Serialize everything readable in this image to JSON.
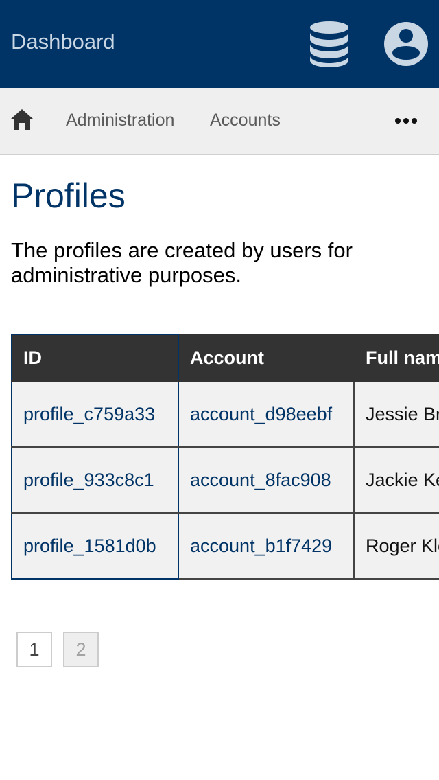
{
  "header": {
    "title": "Dashboard",
    "icons": [
      "database-icon",
      "user-account-icon"
    ]
  },
  "nav": {
    "home_icon": "home-icon",
    "items": [
      {
        "label": "Administration"
      },
      {
        "label": "Accounts"
      }
    ],
    "more_icon": "more-horizontal-icon"
  },
  "page": {
    "title": "Profiles",
    "description": "The profiles are created by users for administrative purposes."
  },
  "table": {
    "columns": [
      "ID",
      "Account",
      "Full name"
    ],
    "rows": [
      {
        "id": "profile_c759a33",
        "account": "account_d98eebf",
        "full_name": "Jessie Breitenberg"
      },
      {
        "id": "profile_933c8c1",
        "account": "account_8fac908",
        "full_name": "Jackie Keeling"
      },
      {
        "id": "profile_1581d0b",
        "account": "account_b1f7429",
        "full_name": "Roger Klein"
      }
    ]
  },
  "pagination": {
    "pages": [
      "1",
      "2"
    ],
    "current": "1"
  },
  "colors": {
    "header_bg": "#003366",
    "nav_bg": "#efefef",
    "table_header_bg": "#333333",
    "link": "#003366"
  }
}
